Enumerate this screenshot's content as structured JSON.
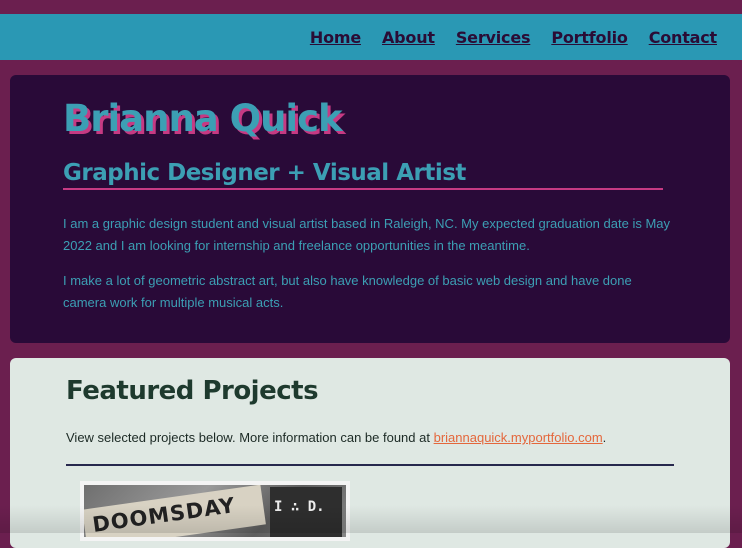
{
  "nav": {
    "items": [
      "Home",
      "About",
      "Services",
      "Portfolio",
      "Contact"
    ]
  },
  "hero": {
    "name": "Brianna Quick",
    "subtitle": "Graphic Designer + Visual Artist",
    "paragraphs": [
      "I am a graphic design student and visual artist based in Raleigh, NC. My expected graduation date is May 2022 and I am looking for internship and freelance opportunities in the meantime.",
      "I make a lot of geometric abstract art, but also have knowledge of basic web design and have done camera work for multiple musical acts."
    ]
  },
  "projects": {
    "heading": "Featured Projects",
    "description_prefix": "View selected projects below. More information can be found at ",
    "link_text": "briannaquick.myportfolio.com",
    "description_suffix": ".",
    "thumbnail": {
      "word": "DOOMSDAY",
      "letters": "I ∴ D."
    }
  },
  "colors": {
    "background": "#6b1f4f",
    "nav_bar": "#2a98b4",
    "nav_text": "#2a0c35",
    "hero_bg": "#290a38",
    "accent_teal": "#3c9fb4",
    "accent_pink": "#c63a83",
    "projects_bg": "#dfe8e3",
    "projects_heading": "#1e3a2e",
    "link": "#e4673c"
  }
}
